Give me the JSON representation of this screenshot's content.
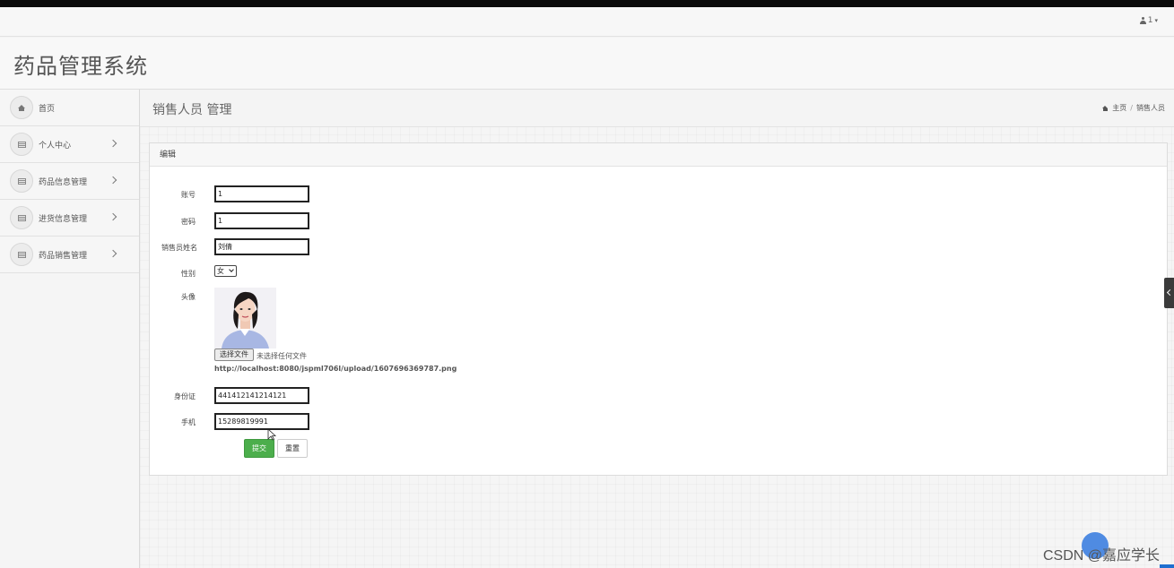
{
  "topbar": {
    "user_label": "1"
  },
  "app": {
    "title": "药品管理系统"
  },
  "sidebar": {
    "items": [
      {
        "label": "首页",
        "icon": "home-icon",
        "has_chevron": false
      },
      {
        "label": "个人中心",
        "icon": "list-icon",
        "has_chevron": true
      },
      {
        "label": "药品信息管理",
        "icon": "list-icon",
        "has_chevron": true
      },
      {
        "label": "进货信息管理",
        "icon": "list-icon",
        "has_chevron": true
      },
      {
        "label": "药品销售管理",
        "icon": "list-icon",
        "has_chevron": true
      }
    ]
  },
  "page": {
    "title": "销售人员 管理",
    "breadcrumb": {
      "home": "主页",
      "separator": "/",
      "current": "销售人员"
    }
  },
  "panel": {
    "title": "编辑"
  },
  "form": {
    "account": {
      "label": "账号",
      "value": "1"
    },
    "password": {
      "label": "密码",
      "value": "1"
    },
    "name": {
      "label": "销售员姓名",
      "value": "刘倩"
    },
    "gender": {
      "label": "性别",
      "value": "女"
    },
    "avatar": {
      "label": "头像",
      "file_button": "选择文件",
      "file_status": "未选择任何文件",
      "path": "http://localhost:8080/jspml706l/upload/1607696369787.png"
    },
    "id_card": {
      "label": "身份证",
      "value": "441412141214121"
    },
    "phone": {
      "label": "手机",
      "value": "15289819991"
    },
    "submit_label": "提交",
    "reset_label": "重置"
  },
  "watermark": "CSDN @嘉应学长",
  "colors": {
    "submit": "#4cae4c",
    "corner": "#1e6fd0"
  }
}
